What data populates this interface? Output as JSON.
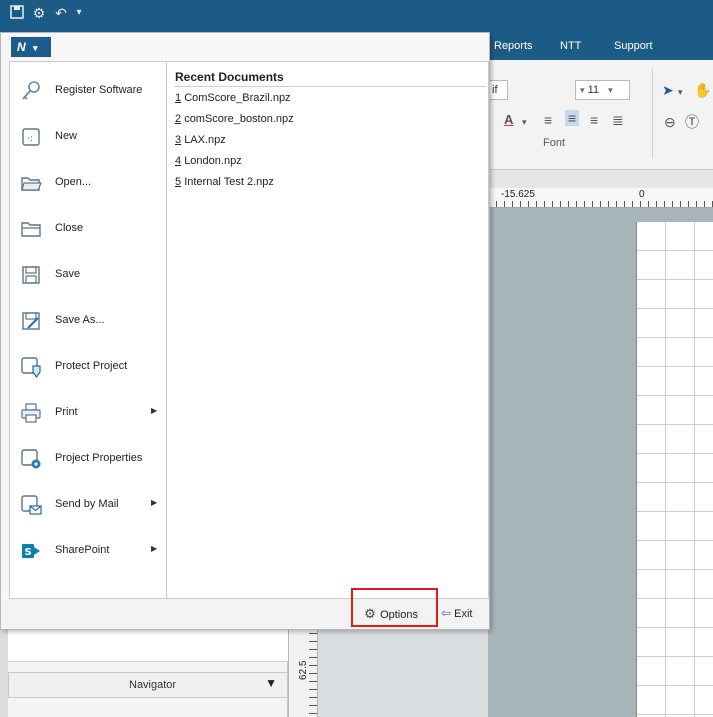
{
  "quick_access": {
    "icons": [
      "save-icon",
      "gear-icon",
      "undo-icon",
      "customize-icon"
    ]
  },
  "app_menu_button": {
    "label": "N",
    "caret": "▾"
  },
  "ribbon_tabs": [
    "Reports",
    "NTT",
    "Support"
  ],
  "ribbon": {
    "font_size": "11",
    "font_name": "if",
    "font_group_caption": "Font"
  },
  "ruler": {
    "horizontal_labels": [
      "-15.625",
      "0"
    ],
    "vertical_label": "62.5"
  },
  "menu": {
    "left_items": [
      {
        "name": "register-software",
        "label": "Register Software",
        "icon": "key-icon",
        "has_submenu": false
      },
      {
        "name": "new",
        "label": "New",
        "icon": "new-document-icon",
        "has_submenu": false
      },
      {
        "name": "open",
        "label": "Open...",
        "icon": "open-folder-icon",
        "has_submenu": false
      },
      {
        "name": "close",
        "label": "Close",
        "icon": "close-folder-icon",
        "has_submenu": false
      },
      {
        "name": "save",
        "label": "Save",
        "icon": "save-icon",
        "has_submenu": false
      },
      {
        "name": "save-as",
        "label": "Save As...",
        "icon": "save-as-icon",
        "has_submenu": false
      },
      {
        "name": "protect-project",
        "label": "Protect Project",
        "icon": "protect-icon",
        "has_submenu": false
      },
      {
        "name": "print",
        "label": "Print",
        "icon": "printer-icon",
        "has_submenu": true
      },
      {
        "name": "project-properties",
        "label": "Project Properties",
        "icon": "properties-icon",
        "has_submenu": false
      },
      {
        "name": "send-by-mail",
        "label": "Send by Mail",
        "icon": "mail-icon",
        "has_submenu": true
      },
      {
        "name": "sharepoint",
        "label": "SharePoint",
        "icon": "sharepoint-icon",
        "has_submenu": true
      }
    ],
    "recent_title": "Recent Documents",
    "recent_documents": [
      {
        "num": "1",
        "name": "ComScore_Brazil.npz"
      },
      {
        "num": "2",
        "name": "comScore_boston.npz"
      },
      {
        "num": "3",
        "name": "LAX.npz"
      },
      {
        "num": "4",
        "name": "London.npz"
      },
      {
        "num": "5",
        "name": "Internal Test 2.npz"
      }
    ],
    "options_label": "Options",
    "exit_label": "Exit"
  },
  "navigator": {
    "label": "Navigator"
  },
  "colors": {
    "title_bar": "#1d5b87",
    "highlight": "#e3191c",
    "canvas": "#a7b4b9"
  }
}
